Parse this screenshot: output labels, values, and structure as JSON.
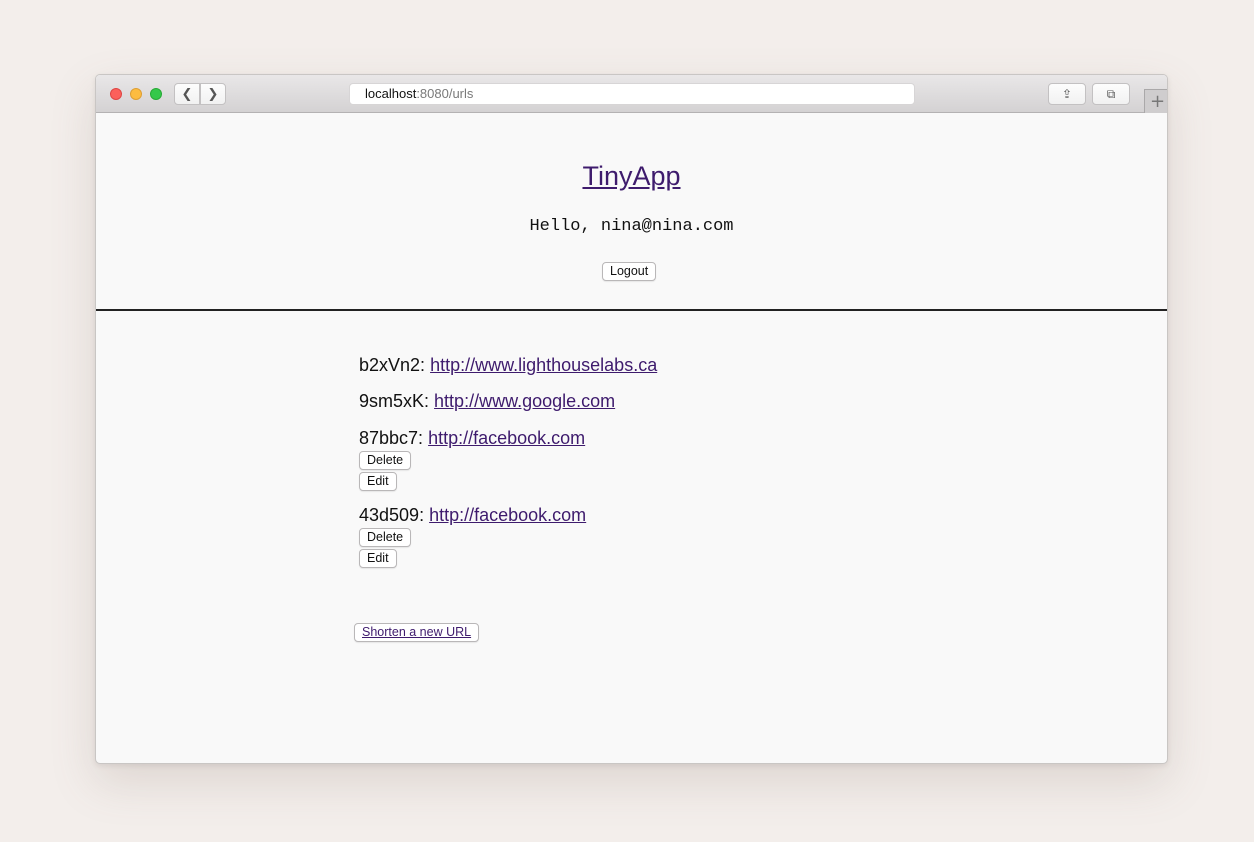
{
  "browser": {
    "address_host": "localhost",
    "address_path": ":8080/urls",
    "back_glyph": "❮",
    "forward_glyph": "❯",
    "share_glyph": "⇪",
    "tabs_glyph": "⧉",
    "new_tab_glyph": "+"
  },
  "header": {
    "title": "TinyApp",
    "greeting": "Hello, nina@nina.com",
    "logout_label": "Logout"
  },
  "urls": [
    {
      "id_label": "b2xVn2:",
      "link": "http://www.lighthouselabs.ca",
      "delete_label": "",
      "edit_label": ""
    },
    {
      "id_label": "9sm5xK:",
      "link": "http://www.google.com",
      "delete_label": "",
      "edit_label": ""
    },
    {
      "id_label": "87bbc7:",
      "link": "http://facebook.com",
      "delete_label": "Delete",
      "edit_label": "Edit"
    },
    {
      "id_label": "43d509:",
      "link": "http://facebook.com",
      "delete_label": "Delete",
      "edit_label": "Edit"
    }
  ],
  "footer": {
    "shorten_label": "Shorten a new URL"
  }
}
